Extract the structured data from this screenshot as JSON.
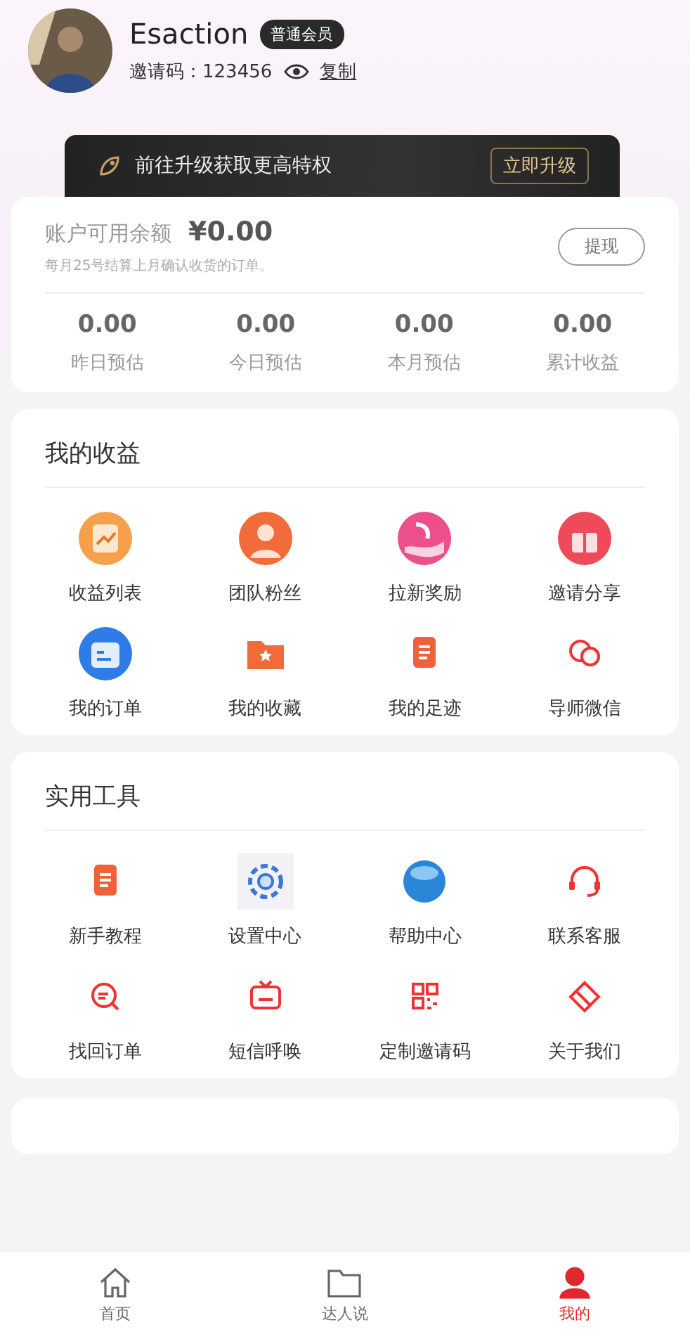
{
  "profile": {
    "name": "Esaction",
    "badge": "普通会员",
    "invite_label": "邀请码：",
    "invite_code": "123456",
    "copy": "复制"
  },
  "upgrade": {
    "text": "前往升级获取更高特权",
    "button": "立即升级"
  },
  "balance": {
    "label": "账户可用余额",
    "amount": "¥0.00",
    "note": "每月25号结算上月确认收货的订单。",
    "button": "提现",
    "stats": [
      {
        "value": "0.00",
        "label": "昨日预估"
      },
      {
        "value": "0.00",
        "label": "今日预估"
      },
      {
        "value": "0.00",
        "label": "本月预估"
      },
      {
        "value": "0.00",
        "label": "累计收益"
      }
    ]
  },
  "sections": [
    {
      "title": "我的收益",
      "items": [
        "收益列表",
        "团队粉丝",
        "拉新奖励",
        "邀请分享",
        "我的订单",
        "我的收藏",
        "我的足迹",
        "导师微信"
      ]
    },
    {
      "title": "实用工具",
      "items": [
        "新手教程",
        "设置中心",
        "帮助中心",
        "联系客服",
        "找回订单",
        "短信呼唤",
        "定制邀请码",
        "关于我们"
      ]
    }
  ],
  "tabs": [
    {
      "label": "首页",
      "selected": false
    },
    {
      "label": "达人说",
      "selected": false
    },
    {
      "label": "我的",
      "selected": true
    }
  ]
}
